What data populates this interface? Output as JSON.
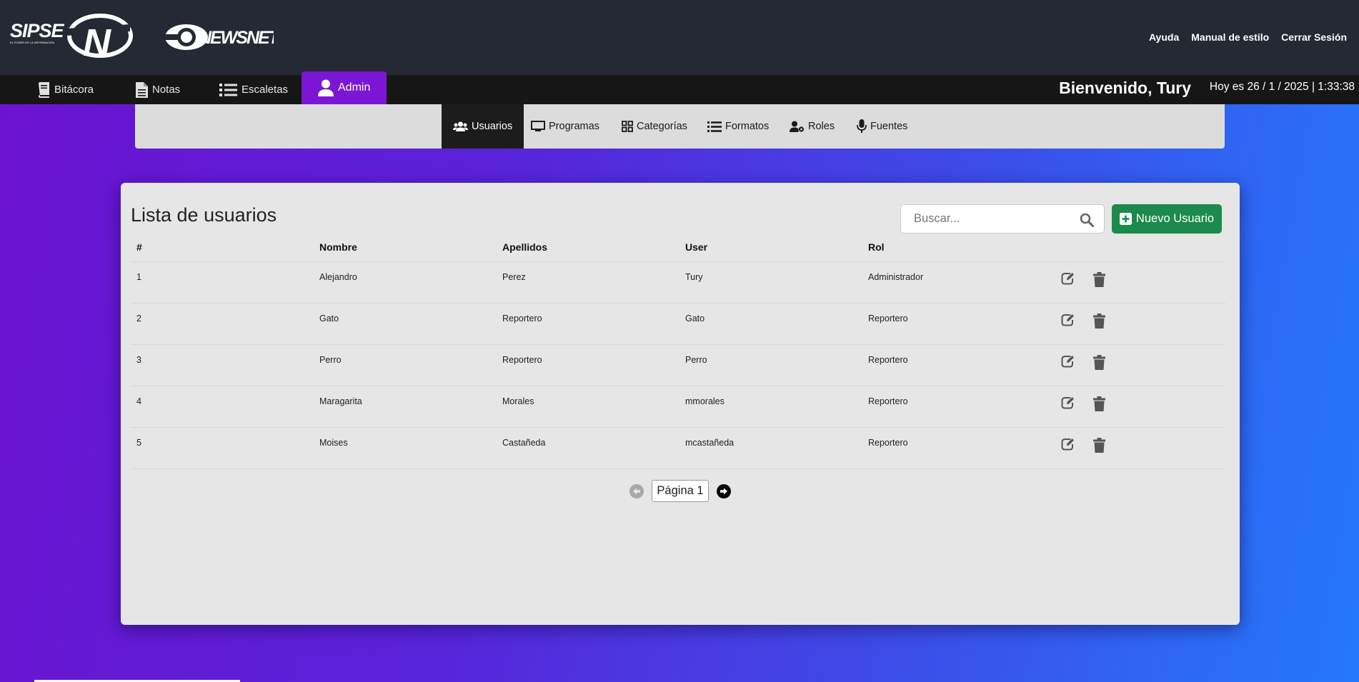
{
  "header": {
    "brand_primary": "SIPSE",
    "brand_tagline": "EL PODER DE LA INFORMACIÓN",
    "brand_secondary": "NEWSNET",
    "links": [
      {
        "label": "Ayuda"
      },
      {
        "label": "Manual de estilo"
      },
      {
        "label": "Cerrar Sesión"
      }
    ]
  },
  "nav": {
    "items": [
      {
        "label": "Bitácora",
        "icon": "book-icon"
      },
      {
        "label": "Notas",
        "icon": "document-icon"
      },
      {
        "label": "Escaletas",
        "icon": "list-icon"
      },
      {
        "label": "Admin",
        "icon": "user-icon",
        "active": true
      }
    ],
    "welcome": "Bienvenido, Tury",
    "datetime": "Hoy es 26 / 1 / 2025 | 1:33:38"
  },
  "subnav": {
    "items": [
      {
        "label": "Usuarios",
        "icon": "users-icon",
        "active": true
      },
      {
        "label": "Programas",
        "icon": "monitor-icon"
      },
      {
        "label": "Categorías",
        "icon": "grid-icon"
      },
      {
        "label": "Formatos",
        "icon": "list-icon"
      },
      {
        "label": "Roles",
        "icon": "user-gear-icon"
      },
      {
        "label": "Fuentes",
        "icon": "microphone-icon"
      }
    ]
  },
  "main": {
    "title": "Lista de usuarios",
    "search_placeholder": "Buscar...",
    "search_value": "",
    "new_button": "Nuevo Usuario",
    "table": {
      "columns": [
        "#",
        "Nombre",
        "Apellidos",
        "User",
        "Rol"
      ],
      "rows": [
        [
          "1",
          "Alejandro",
          "Perez",
          "Tury",
          "Administrador"
        ],
        [
          "2",
          "Gato",
          "Reportero",
          "Gato",
          "Reportero"
        ],
        [
          "3",
          "Perro",
          "Reportero",
          "Perro",
          "Reportero"
        ],
        [
          "4",
          "Maragarita",
          "Morales",
          "mmorales",
          "Reportero"
        ],
        [
          "5",
          "Moises",
          "Castañeda",
          "mcastañeda",
          "Reportero"
        ]
      ]
    },
    "pager": {
      "label": "Página 1"
    }
  },
  "colors": {
    "header_bg": "#242933",
    "nav_bg": "#161616",
    "admin_active": "#7b17d4",
    "new_button": "#1b8a4c",
    "card_bg": "#e6e6e6"
  }
}
